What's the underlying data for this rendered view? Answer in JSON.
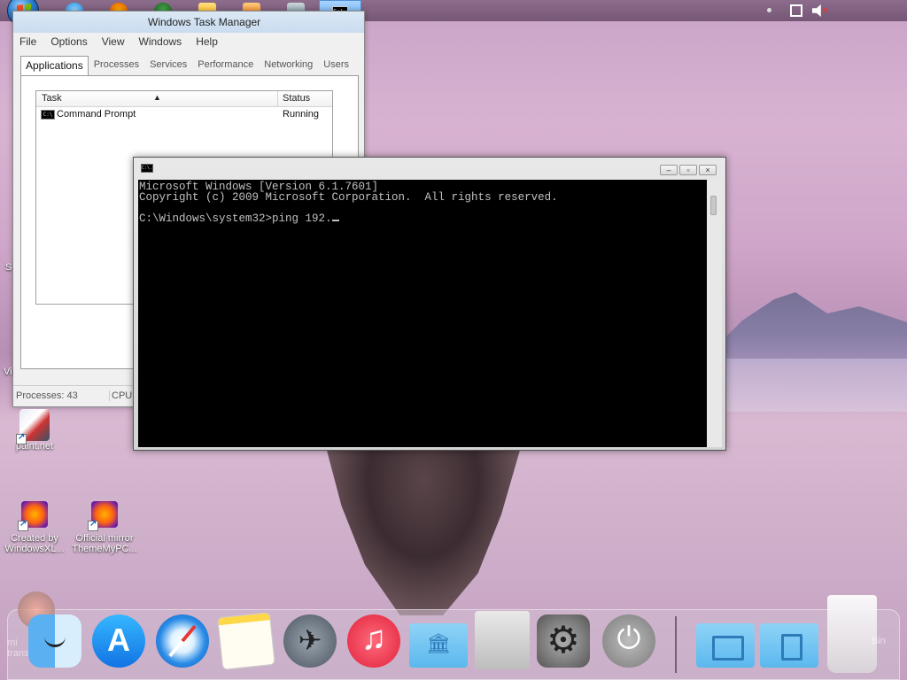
{
  "taskmanager": {
    "title": "Windows Task Manager",
    "menu": [
      "File",
      "Options",
      "View",
      "Windows",
      "Help"
    ],
    "tabs": [
      "Applications",
      "Processes",
      "Services",
      "Performance",
      "Networking",
      "Users"
    ],
    "columns": {
      "task": "Task",
      "status": "Status"
    },
    "rows": [
      {
        "task": "Command Prompt",
        "status": "Running"
      }
    ],
    "status": {
      "processes": "Processes: 43",
      "cpu": "CPU U"
    }
  },
  "cmd": {
    "icon_text": "C:\\.",
    "lines": [
      "Microsoft Windows [Version 6.1.7601]",
      "Copyright (c) 2009 Microsoft Corporation.  All rights reserved.",
      "",
      "C:\\Windows\\system32>ping 192."
    ]
  },
  "desktop": {
    "icons": [
      {
        "label": "paint.net"
      },
      {
        "label_line1": "Created by",
        "label_line2": "WindowsXL..."
      },
      {
        "label_line1": "Official mirror",
        "label_line2": "ThemeMyPC..."
      }
    ],
    "edge_left_1": "S",
    "edge_left_2": "Vi",
    "dock_left_label_1": "mi",
    "dock_left_label_2": "trans"
  },
  "dock": {
    "trash_label": "Bin"
  },
  "taskbar": {
    "active_icon_text": "C:\\."
  }
}
